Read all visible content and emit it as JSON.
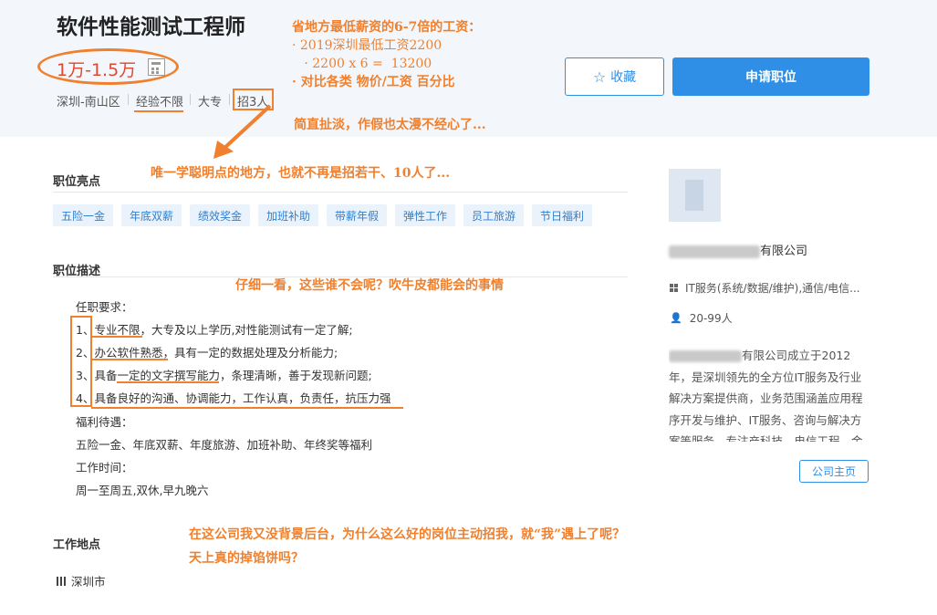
{
  "job": {
    "title": "软件性能测试工程师",
    "salary": "1万-1.5万",
    "location": "深圳-南山区",
    "experience": "经验不限",
    "education": "大专",
    "headcount": "招3人"
  },
  "actions": {
    "favorite_label": "收藏",
    "apply_label": "申请职位"
  },
  "annotations": {
    "salary_note": [
      "省地方最低薪资的6-7倍的工资：",
      "· 2019深圳最低工资2200",
      "   · 2200 x 6 =  13200",
      "· 对比各类 物价/工资 百分比"
    ],
    "fake_note": "简直扯淡，作假也太漫不经心了...",
    "headcount_note": "唯一学聪明点的地方，也就不再是招若干、10人了...",
    "requirements_note": "仔细一看，这些谁不会呢？吹牛皮都能会的事情",
    "closing_note": [
      "在这公司我又没背景后台，为什么这么好的岗位主动招我，就“我”遇上了呢？",
      "天上真的掉馅饼吗？"
    ]
  },
  "highlights": {
    "title": "职位亮点",
    "tags": [
      "五险一金",
      "年底双薪",
      "绩效奖金",
      "加班补助",
      "带薪年假",
      "弹性工作",
      "员工旅游",
      "节日福利"
    ]
  },
  "description": {
    "title": "职位描述",
    "lines": [
      "任职要求：",
      "1、专业不限，大专及以上学历,对性能测试有一定了解;",
      "2、办公软件熟悉，具有一定的数据处理及分析能力;",
      "3、具备一定的文字撰写能力，条理清晰，善于发现新问题;",
      "4、具备良好的沟通、协调能力，工作认真，负责任，抗压力强",
      "福利待遇：",
      "五险一金、年底双薪、年度旅游、加班补助、年终奖等福利",
      "工作时间：",
      "周一至周五,双休,早九晚六"
    ]
  },
  "work_location": {
    "title": "工作地点",
    "city": "深圳市"
  },
  "company": {
    "name_suffix": "有限公司",
    "industry": "IT服务(系统/数据/维护),通信/电信...",
    "size": "20-99人",
    "about": "有限公司成立于2012年，是深圳领先的全方位IT服务及行业解决方案提供商，业务范围涵盖应用程序开发与维护、IT服务、咨询与解决方案等服务，专注产科技，电信工程，金融服务",
    "home_label": "公司主页"
  },
  "colors": {
    "accent": "#2f8ee5",
    "salary": "#e0472f",
    "annotation": "#f0802d",
    "tag_bg": "#eaf3fc"
  }
}
